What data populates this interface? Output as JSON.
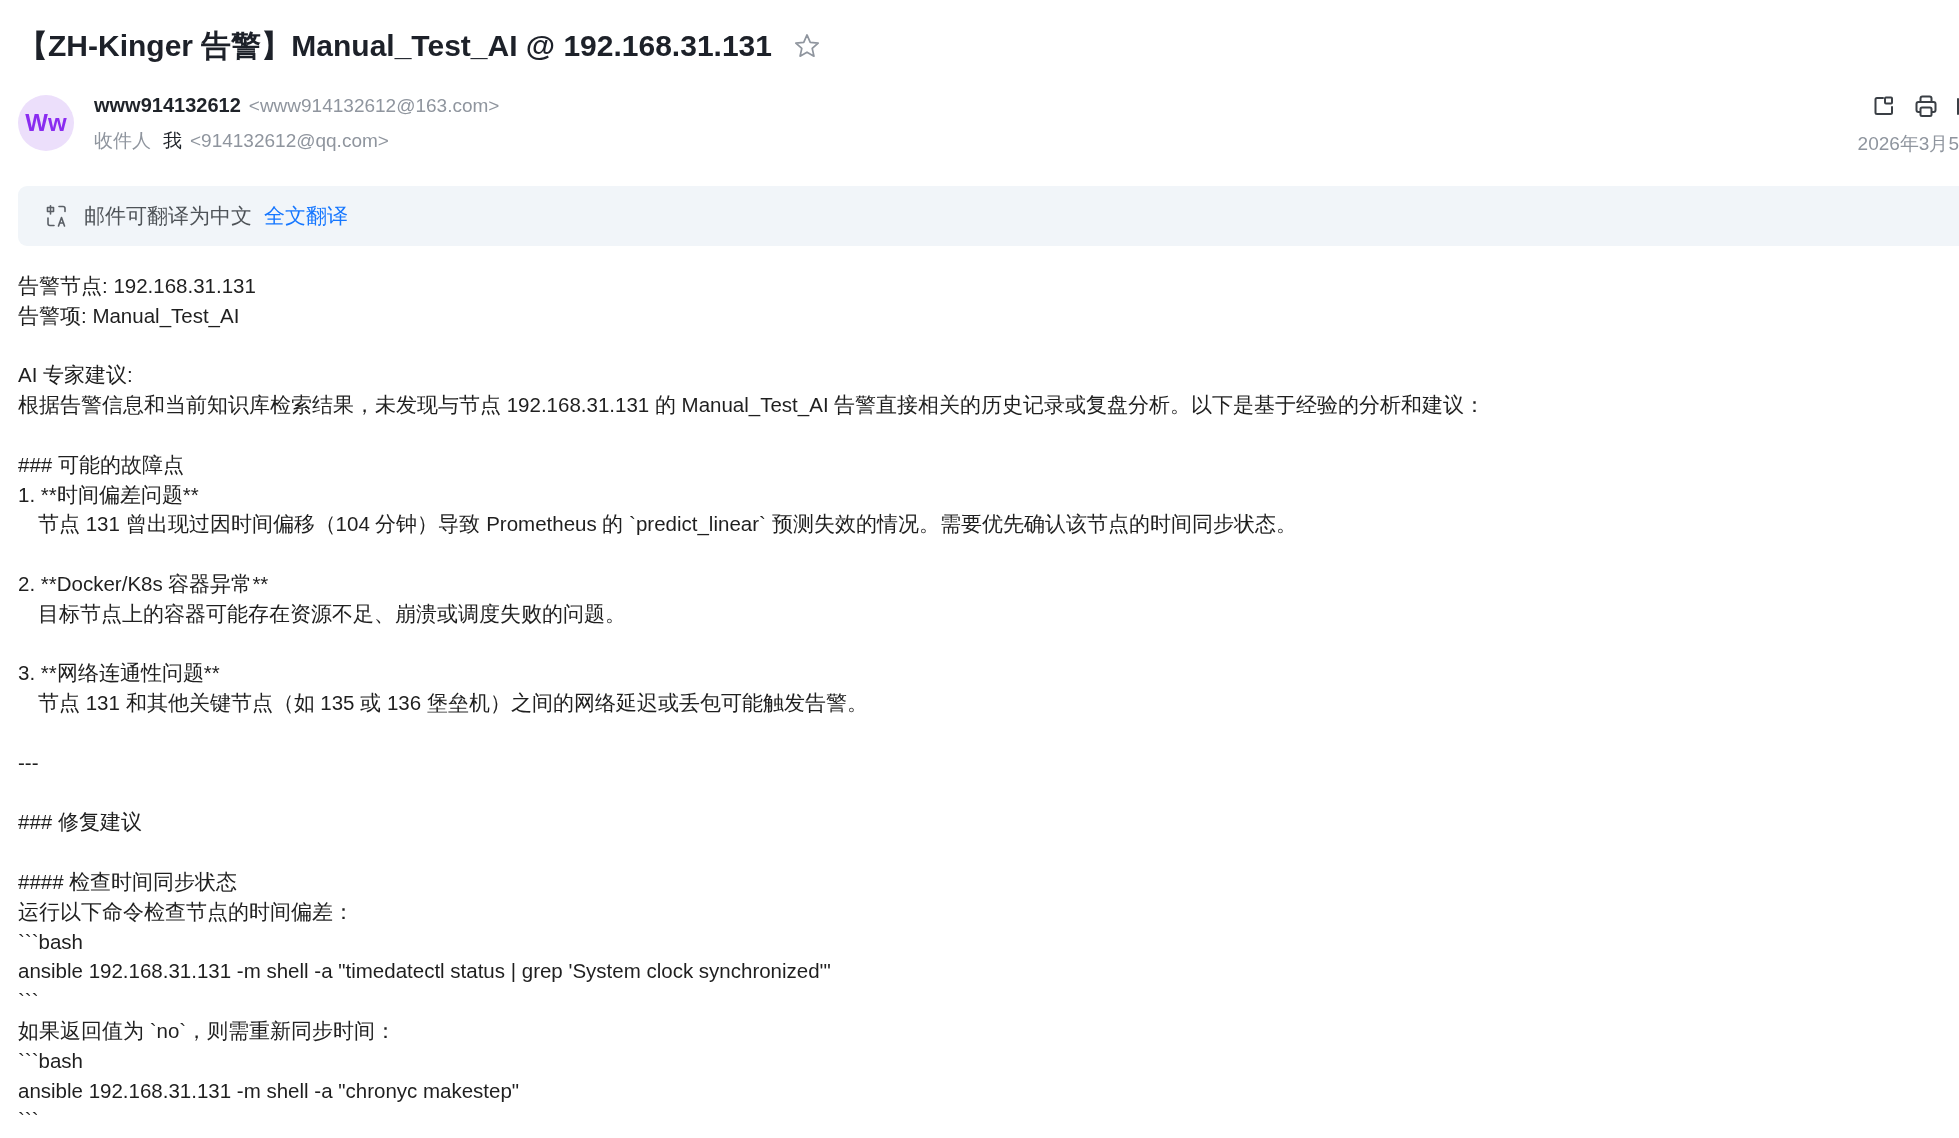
{
  "email": {
    "subject": "【ZH-Kinger 告警】Manual_Test_AI @ 192.168.31.131",
    "starred": false,
    "sender": {
      "avatar_initials": "Ww",
      "name": "www914132612",
      "address": "<www914132612@163.com>"
    },
    "recipient": {
      "label": "收件人",
      "name": "我",
      "address": "<914132612@qq.com>"
    },
    "date": "2026年3月5",
    "translation_bar": {
      "message": "邮件可翻译为中文",
      "link": "全文翻译"
    },
    "body": {
      "paragraphs": [
        [
          {
            "kind": "plain",
            "text": "告警节点: 192.168.31.131"
          },
          {
            "kind": "plain",
            "text": "告警项: Manual_Test_AI"
          }
        ],
        [
          {
            "kind": "plain",
            "text": "AI 专家建议:"
          },
          {
            "kind": "plain",
            "text": "根据告警信息和当前知识库检索结果，未发现与节点 192.168.31.131 的 Manual_Test_AI 告警直接相关的历史记录或复盘分析。以下是基于经验的分析和建议："
          }
        ],
        [
          {
            "kind": "plain",
            "text": "### 可能的故障点"
          },
          {
            "kind": "plain",
            "text": "1. **时间偏差问题**"
          },
          {
            "kind": "indented",
            "text": "节点 131 曾出现过因时间偏移（104 分钟）导致 Prometheus 的 `predict_linear` 预测失效的情况。需要优先确认该节点的时间同步状态。"
          }
        ],
        [
          {
            "kind": "plain",
            "text": "2. **Docker/K8s 容器异常**"
          },
          {
            "kind": "indented",
            "text": "目标节点上的容器可能存在资源不足、崩溃或调度失败的问题。"
          }
        ],
        [
          {
            "kind": "plain",
            "text": "3. **网络连通性问题**"
          },
          {
            "kind": "indented",
            "text": "节点 131 和其他关键节点（如 135 或 136 堡垒机）之间的网络延迟或丢包可能触发告警。"
          }
        ],
        [
          {
            "kind": "plain",
            "text": "---"
          }
        ],
        [
          {
            "kind": "plain",
            "text": "### 修复建议"
          }
        ],
        [
          {
            "kind": "plain",
            "text": "#### 检查时间同步状态"
          },
          {
            "kind": "plain",
            "text": "运行以下命令检查节点的时间偏差："
          },
          {
            "kind": "plain",
            "text": "```bash"
          },
          {
            "kind": "plain",
            "text": "ansible 192.168.31.131 -m shell -a \"timedatectl status | grep 'System clock synchronized'\""
          },
          {
            "kind": "plain",
            "text": "```"
          },
          {
            "kind": "plain",
            "text": "如果返回值为 `no`，则需重新同步时间："
          },
          {
            "kind": "plain",
            "text": "```bash"
          },
          {
            "kind": "plain",
            "text": "ansible 192.168.31.131 -m shell -a \"chronyc makestep\""
          },
          {
            "kind": "plain",
            "text": "```"
          }
        ]
      ]
    }
  }
}
